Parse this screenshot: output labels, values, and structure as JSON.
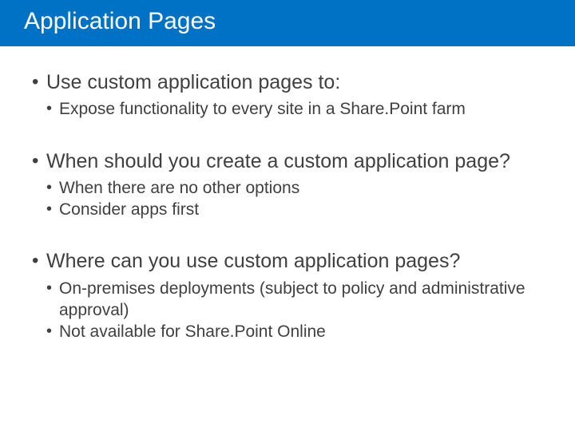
{
  "title": "Application Pages",
  "bullets": [
    {
      "text": "Use custom application pages to:",
      "sub": [
        "Expose functionality to every site in a Share.Point farm"
      ]
    },
    {
      "text": "When should you create a custom application page?",
      "sub": [
        "When there are no other options",
        "Consider apps first"
      ]
    },
    {
      "text": "Where can you use custom application pages?",
      "sub": [
        "On-premises deployments (subject to policy and administrative approval)",
        "Not available for Share.Point Online"
      ]
    }
  ]
}
